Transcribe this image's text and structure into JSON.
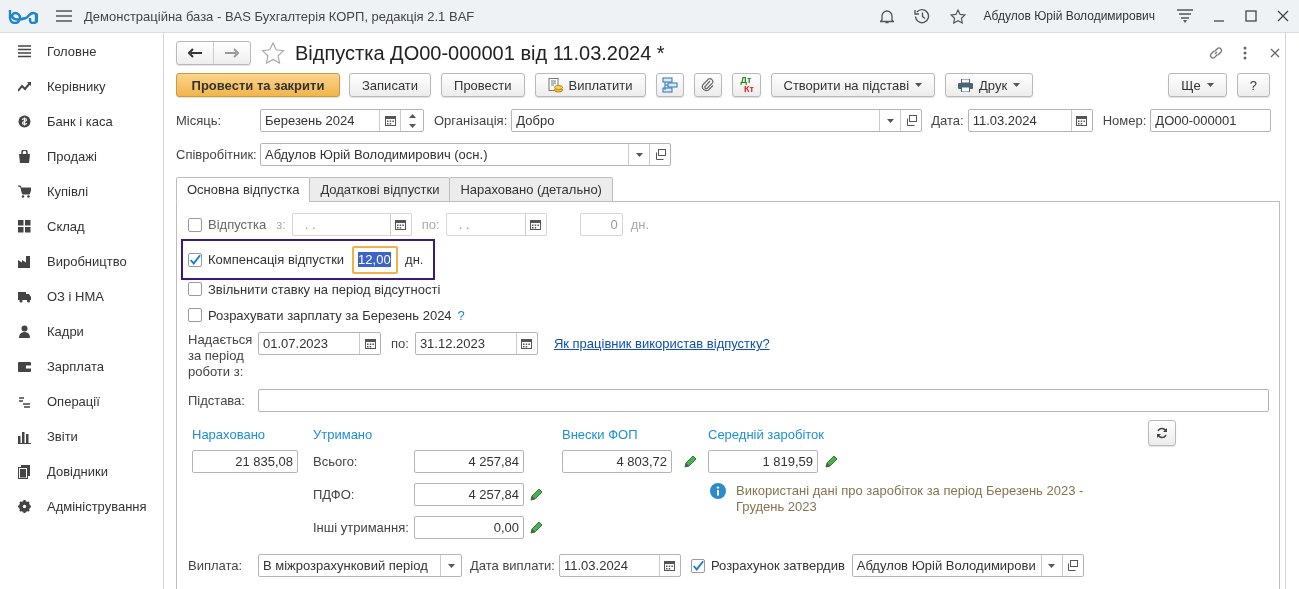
{
  "app": {
    "title": "Демонстраційна база - BAS Бухгалтерія КОРП, редакція 2.1 BAF",
    "user": "Абдулов Юрій Володимирович"
  },
  "sidebar": {
    "items": [
      {
        "label": "Головне"
      },
      {
        "label": "Керівнику"
      },
      {
        "label": "Банк і каса"
      },
      {
        "label": "Продажі"
      },
      {
        "label": "Купівлі"
      },
      {
        "label": "Склад"
      },
      {
        "label": "Виробництво"
      },
      {
        "label": "ОЗ і НМА"
      },
      {
        "label": "Кадри"
      },
      {
        "label": "Зарплата"
      },
      {
        "label": "Операції"
      },
      {
        "label": "Звіти"
      },
      {
        "label": "Довідники"
      },
      {
        "label": "Адміністрування"
      }
    ]
  },
  "document": {
    "title": "Відпустка ДО00-000001 від 11.03.2024 *",
    "favorite": false,
    "toolbar": [
      {
        "kind": "primary",
        "label": "Провести та закрити"
      },
      {
        "kind": "plain",
        "label": "Записати"
      },
      {
        "kind": "plain",
        "label": "Провести"
      },
      {
        "kind": "coins",
        "label": "Виплатити"
      },
      {
        "kind": "structure"
      },
      {
        "kind": "clip"
      },
      {
        "kind": "dtkt",
        "label_top": "Дт",
        "label_bottom": "Кт"
      },
      {
        "kind": "menu",
        "label": "Створити на підставі"
      },
      {
        "kind": "print",
        "label": "Друк"
      }
    ],
    "toolbar_right": [
      {
        "kind": "menu",
        "label": "Ще"
      },
      {
        "kind": "plain",
        "label": "?"
      }
    ]
  },
  "header": {
    "month": {
      "label": "Місяць:",
      "value": "Березень 2024"
    },
    "organization": {
      "label": "Організація:",
      "value": "Добро"
    },
    "date": {
      "label": "Дата:",
      "value": "11.03.2024"
    },
    "number": {
      "label": "Номер:",
      "value": "ДО00-000001"
    },
    "employee": {
      "label": "Співробітник:",
      "value": "Абдулов Юрій Володимирович (осн.)"
    }
  },
  "tabs": [
    {
      "label": "Основна відпустка",
      "selected": true
    },
    {
      "label": "Додаткові відпустки",
      "selected": false
    },
    {
      "label": "Нараховано (детально)",
      "selected": false
    }
  ],
  "vacation": {
    "label": "Відпустка",
    "checked": false,
    "disabled": true,
    "from_label": "з:",
    "from_value": ".  .",
    "to_label": "по:",
    "to_value": ".  .",
    "days": "0",
    "days_unit": "дн."
  },
  "compensation": {
    "label": "Компенсація відпустки",
    "checked": true,
    "highlighted": true,
    "value": "12,00",
    "focused": true,
    "unit": "дн."
  },
  "release_rate": {
    "label": "Звільнити ставку на період відсутності",
    "checked": false
  },
  "calc_salary": {
    "label": "Розрахувати зарплату за Березень 2024",
    "checked": false,
    "help": "?"
  },
  "period": {
    "label": "Надається за період роботи з:",
    "from": "01.07.2023",
    "to_label": "по:",
    "to": "31.12.2023",
    "link": "Як працівник використав відпустку?"
  },
  "basis": {
    "label": "Підстава:"
  },
  "totals": {
    "accrued": {
      "title": "Нараховано",
      "value": "21 835,08"
    },
    "withheld": {
      "title": "Утримано",
      "rows": [
        {
          "label": "Всього:",
          "value": "4 257,84",
          "editable": false
        },
        {
          "label": "ПДФО:",
          "value": "4 257,84",
          "editable": true
        },
        {
          "label": "Інші утримання:",
          "value": "0,00",
          "editable": true
        }
      ]
    },
    "contributions": {
      "title": "Внески ФОП",
      "value": "4 803,72",
      "editable": true
    },
    "average": {
      "title": "Середній заробіток",
      "value": "1 819,59",
      "editable": true,
      "note": "Використані дані про заробіток за період Березень 2023 - Грудень 2023"
    }
  },
  "payment": {
    "label": "Виплата:",
    "value": "В міжрозрахунковий період",
    "date_label": "Дата виплати:",
    "date": "11.03.2024",
    "approved_label": "Розрахунок затвердив",
    "approved": true,
    "approver": "Абдулов Юрій Володимирови"
  }
}
